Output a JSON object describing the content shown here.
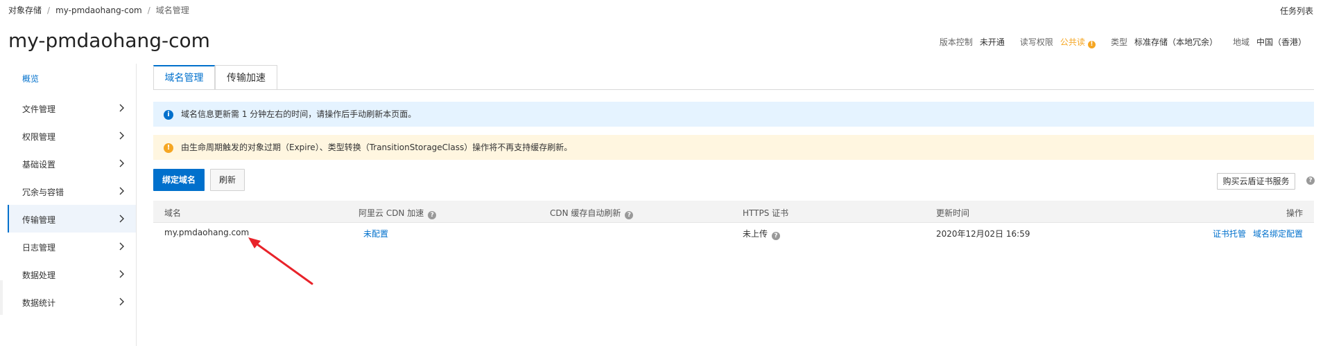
{
  "breadcrumb": [
    "对象存储",
    "my-pmdaohang-com",
    "域名管理"
  ],
  "task_list": "任务列表",
  "page_title": "my-pmdaohang-com",
  "bucket_meta": {
    "versioning_label": "版本控制",
    "versioning_value": "未开通",
    "acl_label": "读写权限",
    "acl_value": "公共读",
    "type_label": "类型",
    "type_value": "标准存储（本地冗余）",
    "region_label": "地域",
    "region_value": "中国（香港）",
    "warn_icon": "!"
  },
  "sidebar": {
    "items": [
      {
        "label": "概览"
      },
      {
        "label": "文件管理"
      },
      {
        "label": "权限管理"
      },
      {
        "label": "基础设置"
      },
      {
        "label": "冗余与容错"
      },
      {
        "label": "传输管理"
      },
      {
        "label": "日志管理"
      },
      {
        "label": "数据处理"
      },
      {
        "label": "数据统计"
      }
    ]
  },
  "tabs": {
    "domain": "域名管理",
    "accel": "传输加速"
  },
  "alerts": {
    "info_icon": "i",
    "info": "域名信息更新需 1 分钟左右的时间，请操作后手动刷新本页面。",
    "warn_icon": "!",
    "warn": "由生命周期触发的对象过期（Expire）、类型转换（TransitionStorageClass）操作将不再支持缓存刷新。"
  },
  "toolbar": {
    "bind": "绑定域名",
    "refresh": "刷新",
    "buy_cert": "购买云盾证书服务",
    "help_icon": "?"
  },
  "table": {
    "headers": {
      "domain": "域名",
      "cdn": "阿里云 CDN 加速",
      "auto_refresh": "CDN 缓存自动刷新",
      "https": "HTTPS 证书",
      "updated": "更新时间",
      "actions": "操作"
    },
    "help_icon": "?",
    "rows": [
      {
        "domain": "my.pmdaohang.com",
        "cdn": "未配置",
        "https": "未上传",
        "updated": "2020年12月02日 16:59",
        "action_cert": "证书托管",
        "action_bind": "域名绑定配置"
      }
    ]
  },
  "colors": {
    "accent": "#0070cc",
    "warning": "#f5a623",
    "info_bg": "#e5f3ff",
    "warn_bg": "#fff6e0",
    "arrow": "#e8232a"
  }
}
